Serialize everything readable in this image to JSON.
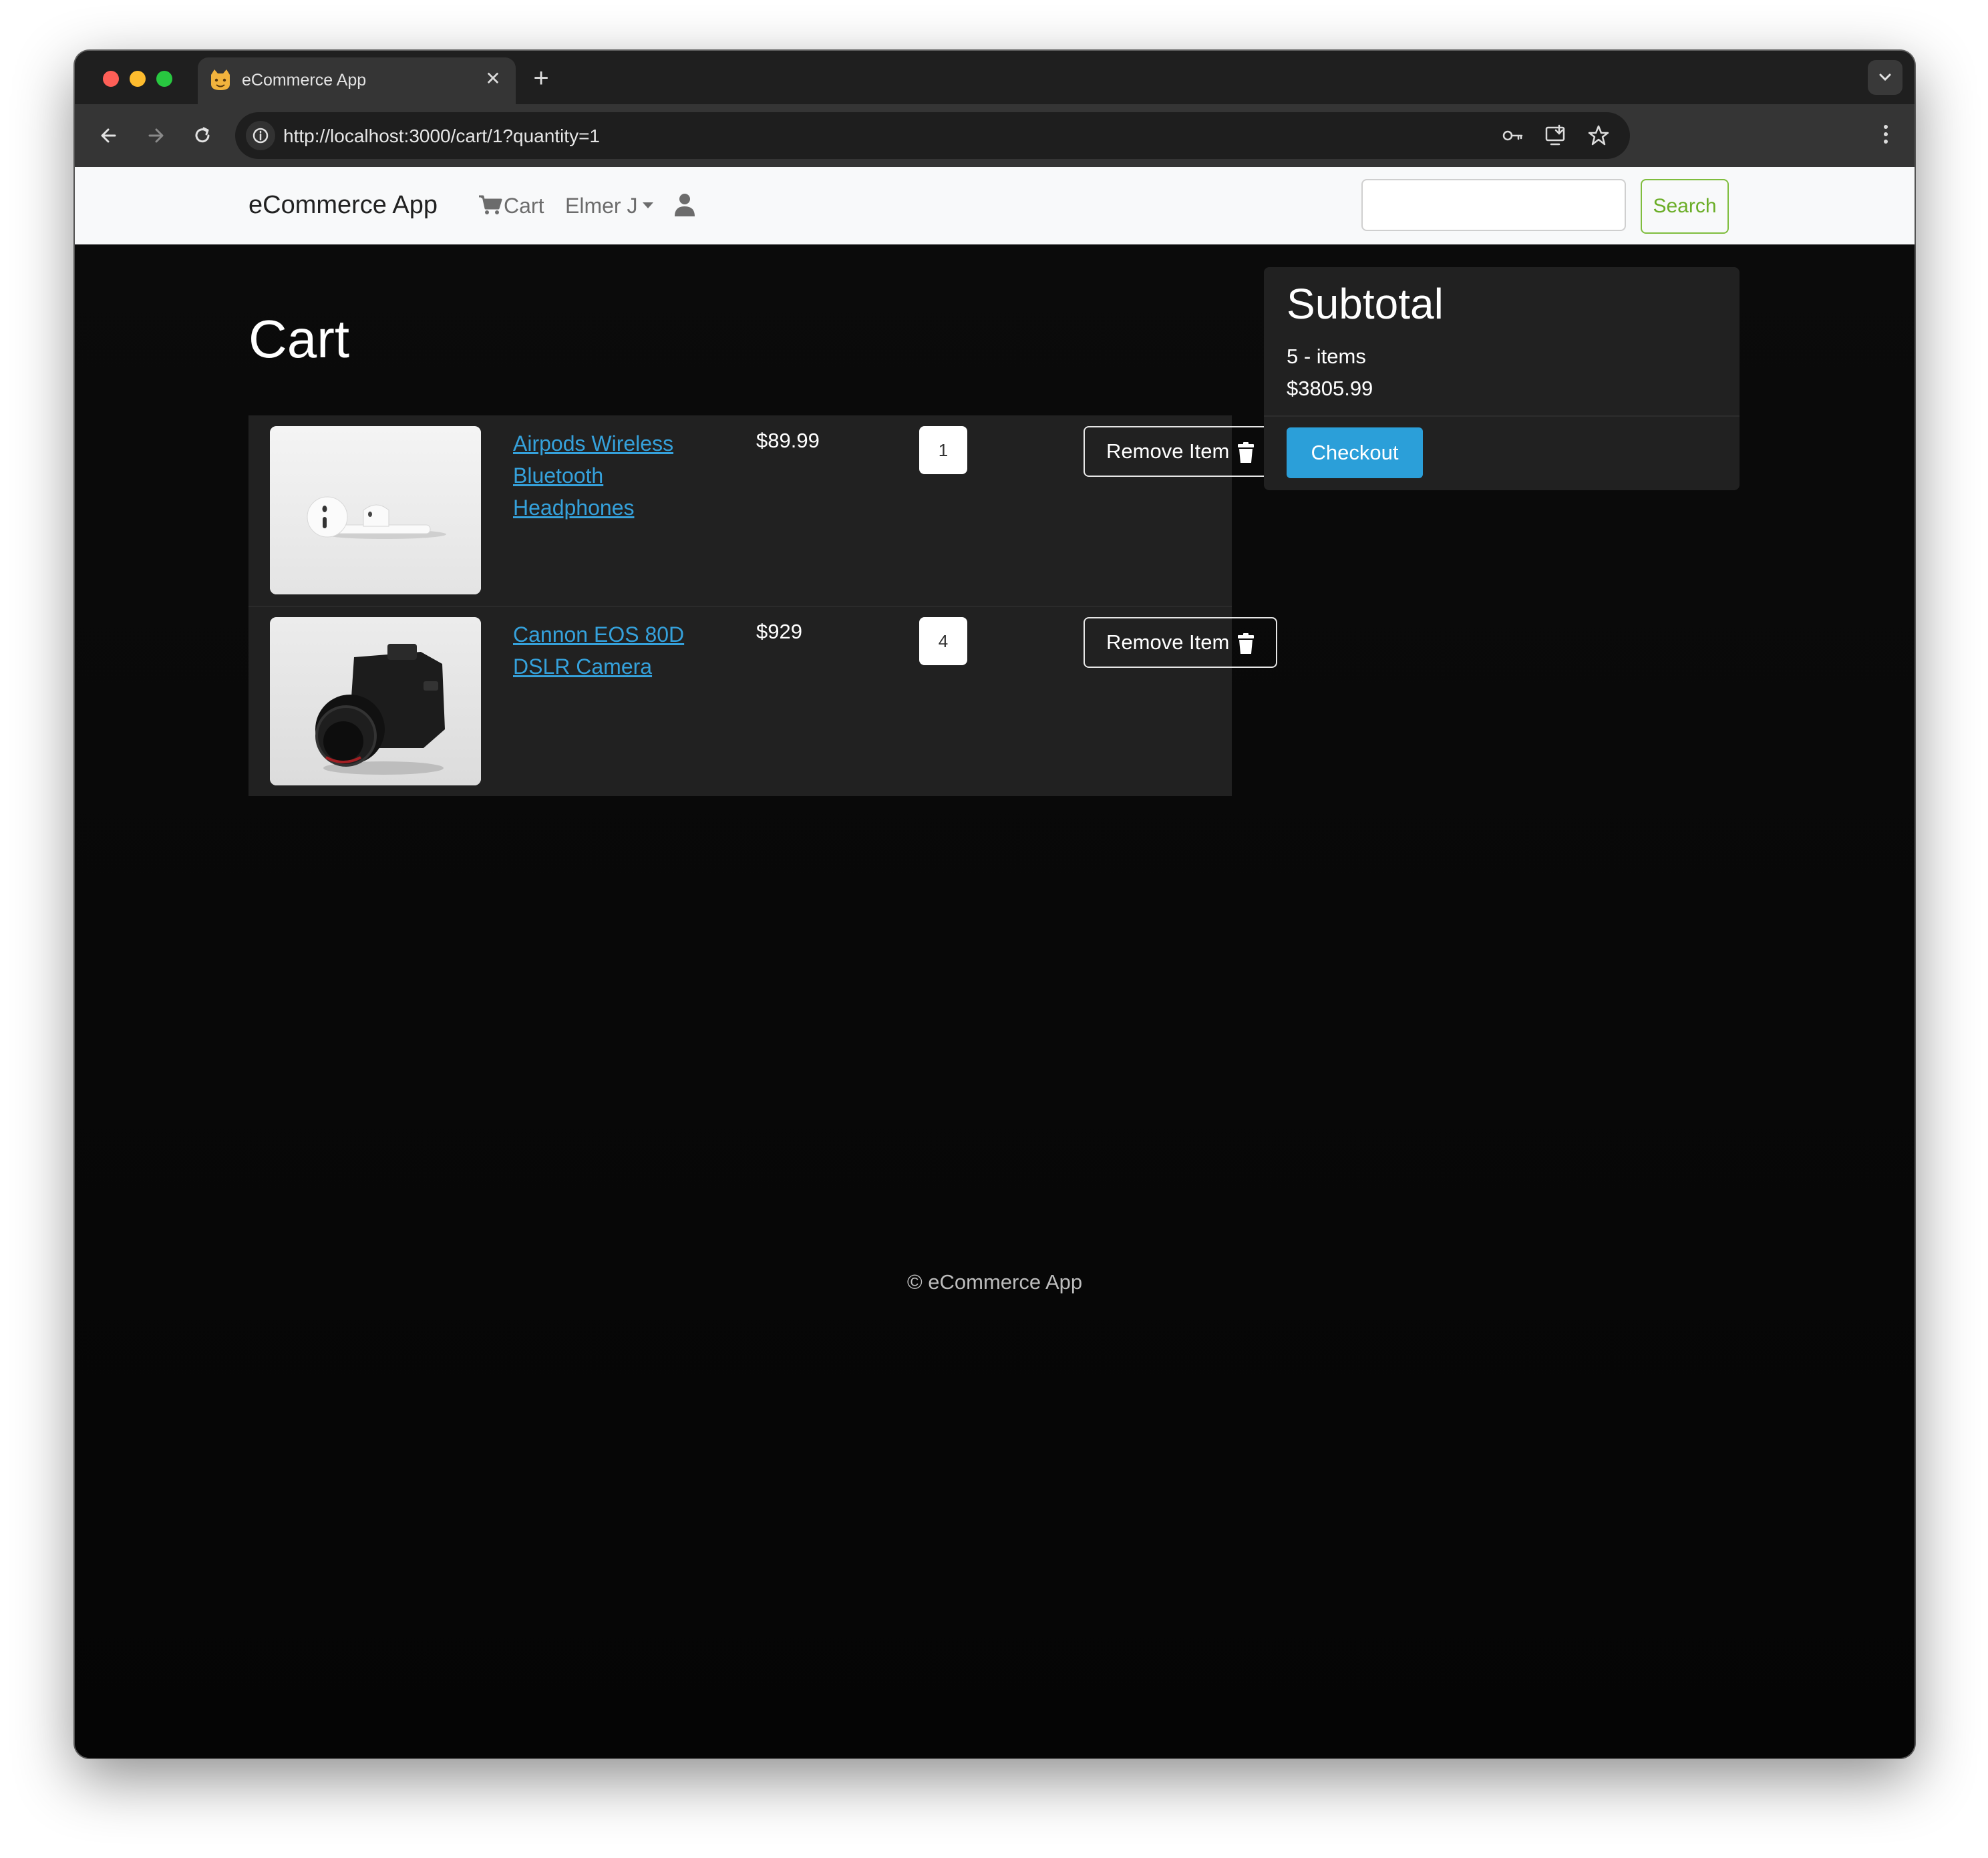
{
  "browser": {
    "tab_title": "eCommerce App",
    "tab_close": "✕",
    "new_tab": "+",
    "url": "http://localhost:3000/cart/1?quantity=1"
  },
  "navbar": {
    "brand": "eCommerce App",
    "cart_label": "Cart",
    "user_label": "Elmer J",
    "search_value": "",
    "search_button": "Search"
  },
  "page": {
    "title": "Cart"
  },
  "cart": {
    "items": [
      {
        "name": "Airpods Wireless Bluetooth Headphones",
        "price": "$89.99",
        "quantity": "1",
        "remove_label": "Remove Item"
      },
      {
        "name": "Cannon EOS 80D DSLR Camera",
        "price": "$929",
        "quantity": "4",
        "remove_label": "Remove Item"
      }
    ]
  },
  "summary": {
    "title": "Subtotal",
    "item_count": "5 - items",
    "total": "$3805.99",
    "checkout_label": "Checkout"
  },
  "footer": {
    "text": "© eCommerce App"
  },
  "colors": {
    "link": "#35a1db",
    "checkout": "#2b9fd9",
    "search_accent": "#6aad26",
    "page_background": "#050505",
    "card_background": "#212121"
  }
}
